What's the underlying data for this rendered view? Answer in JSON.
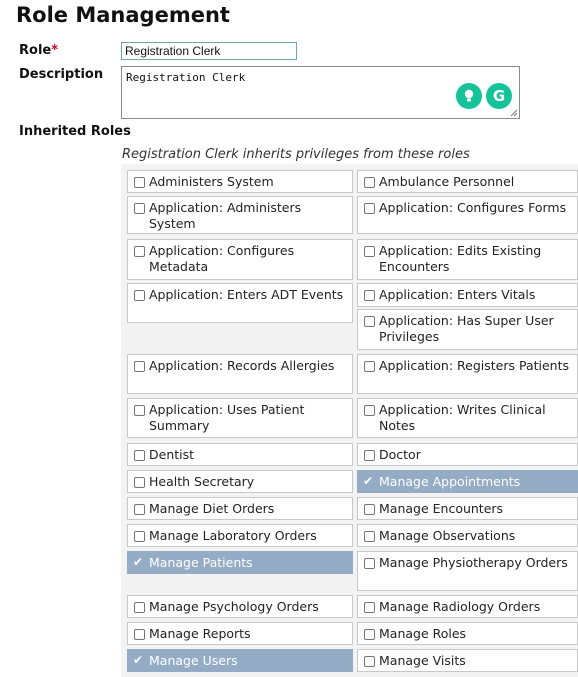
{
  "page": {
    "title": "Role Management"
  },
  "form": {
    "role_label": "Role",
    "required_mark": "*",
    "role_value": "Registration Clerk",
    "description_label": "Description",
    "description_value": "Registration Clerk",
    "grammarly_g": "G"
  },
  "inherited": {
    "label": "Inherited Roles",
    "subtitle": "Registration Clerk inherits privileges from these roles",
    "roles": [
      {
        "label": "Administers System",
        "checked": false
      },
      {
        "label": "Ambulance Personnel",
        "checked": false
      },
      {
        "label": "Application: Administers System",
        "checked": false
      },
      {
        "label": "Application: Configures Forms",
        "checked": false
      },
      {
        "label": "Application: Configures Metadata",
        "checked": false
      },
      {
        "label": "Application: Edits Existing Encounters",
        "checked": false
      },
      {
        "label": "Application: Enters ADT Events",
        "checked": false
      },
      {
        "label": "Application: Enters Vitals",
        "checked": false
      },
      {
        "label": "Application: Has Super User Privileges",
        "checked": false
      },
      {
        "label": "Application: Records Allergies",
        "checked": false
      },
      {
        "label": "Application: Registers Patients",
        "checked": false
      },
      {
        "label": "Application: Uses Patient Summary",
        "checked": false
      },
      {
        "label": "Application: Writes Clinical Notes",
        "checked": false
      },
      {
        "label": "Dentist",
        "checked": false
      },
      {
        "label": "Doctor",
        "checked": false
      },
      {
        "label": "Health Secretary",
        "checked": false
      },
      {
        "label": "Manage Appointments",
        "checked": true
      },
      {
        "label": "Manage Diet Orders",
        "checked": false
      },
      {
        "label": "Manage Encounters",
        "checked": false
      },
      {
        "label": "Manage Laboratory Orders",
        "checked": false
      },
      {
        "label": "Manage Observations",
        "checked": false
      },
      {
        "label": "Manage Patients",
        "checked": true
      },
      {
        "label": "Manage Physiotherapy Orders",
        "checked": false
      },
      {
        "label": "Manage Psychology Orders",
        "checked": false
      },
      {
        "label": "Manage Radiology Orders",
        "checked": false
      },
      {
        "label": "Manage Reports",
        "checked": false
      },
      {
        "label": "Manage Roles",
        "checked": false
      },
      {
        "label": "Manage Users",
        "checked": true
      },
      {
        "label": "Manage Visits",
        "checked": false
      }
    ]
  },
  "colors": {
    "checked_bg": "#95acc7",
    "required": "#d0021b",
    "grammarly": "#15c39a"
  },
  "icons": {
    "grammarly_suggestion": "lightbulb-icon",
    "grammarly_logo": "grammarly-g-icon"
  }
}
